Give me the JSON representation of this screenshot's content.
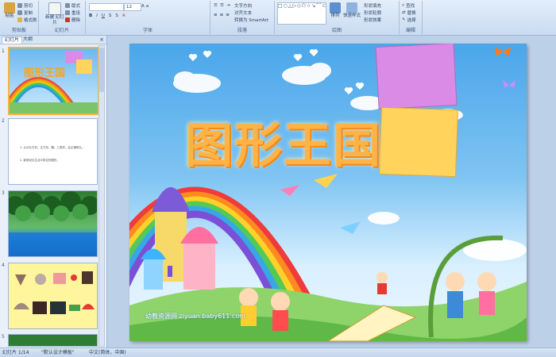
{
  "ribbon": {
    "clipboard": {
      "paste": "粘贴",
      "cut": "剪切",
      "copy": "复制",
      "format_painter": "格式刷",
      "label": "剪贴板"
    },
    "slides": {
      "new_slide": "新建\n幻灯片",
      "layout": "版式",
      "reset": "重设",
      "delete": "删除",
      "label": "幻灯片"
    },
    "font": {
      "font_name": "",
      "font_size": "12",
      "label": "字体"
    },
    "paragraph": {
      "text_direction": "文字方向",
      "align_text": "对齐文本",
      "smartart": "转换为 SmartArt",
      "label": "段落"
    },
    "drawing": {
      "arrange": "排列",
      "quick_styles": "快速样式",
      "shape_fill": "形状填充",
      "shape_outline": "形状轮廓",
      "shape_effects": "形状效果",
      "label": "绘图"
    },
    "editing": {
      "find": "查找",
      "replace": "替换",
      "select": "选择",
      "label": "编辑"
    }
  },
  "pane": {
    "tabs": [
      "幻灯片",
      "大纲"
    ],
    "close": "×",
    "thumbs": [
      {
        "num": "1",
        "title": "图形王国"
      },
      {
        "num": "2",
        "line1": "1. 认识长方形、正方形、圆、三角形，会正确辨认。",
        "line2": "2. 能够说出生活中常见的图形。"
      },
      {
        "num": "3"
      },
      {
        "num": "4"
      },
      {
        "num": "5"
      }
    ]
  },
  "slide": {
    "title": "图形王国",
    "watermark": "幼教资源网 ziyuan.baby611.com"
  },
  "status": {
    "slide_of": "幻灯片 1/14",
    "theme": "\"默认设计模板\"",
    "language": "中文(简体，中国)"
  },
  "colors": {
    "accent": "#4aa6ea",
    "title": "#ffb347"
  }
}
